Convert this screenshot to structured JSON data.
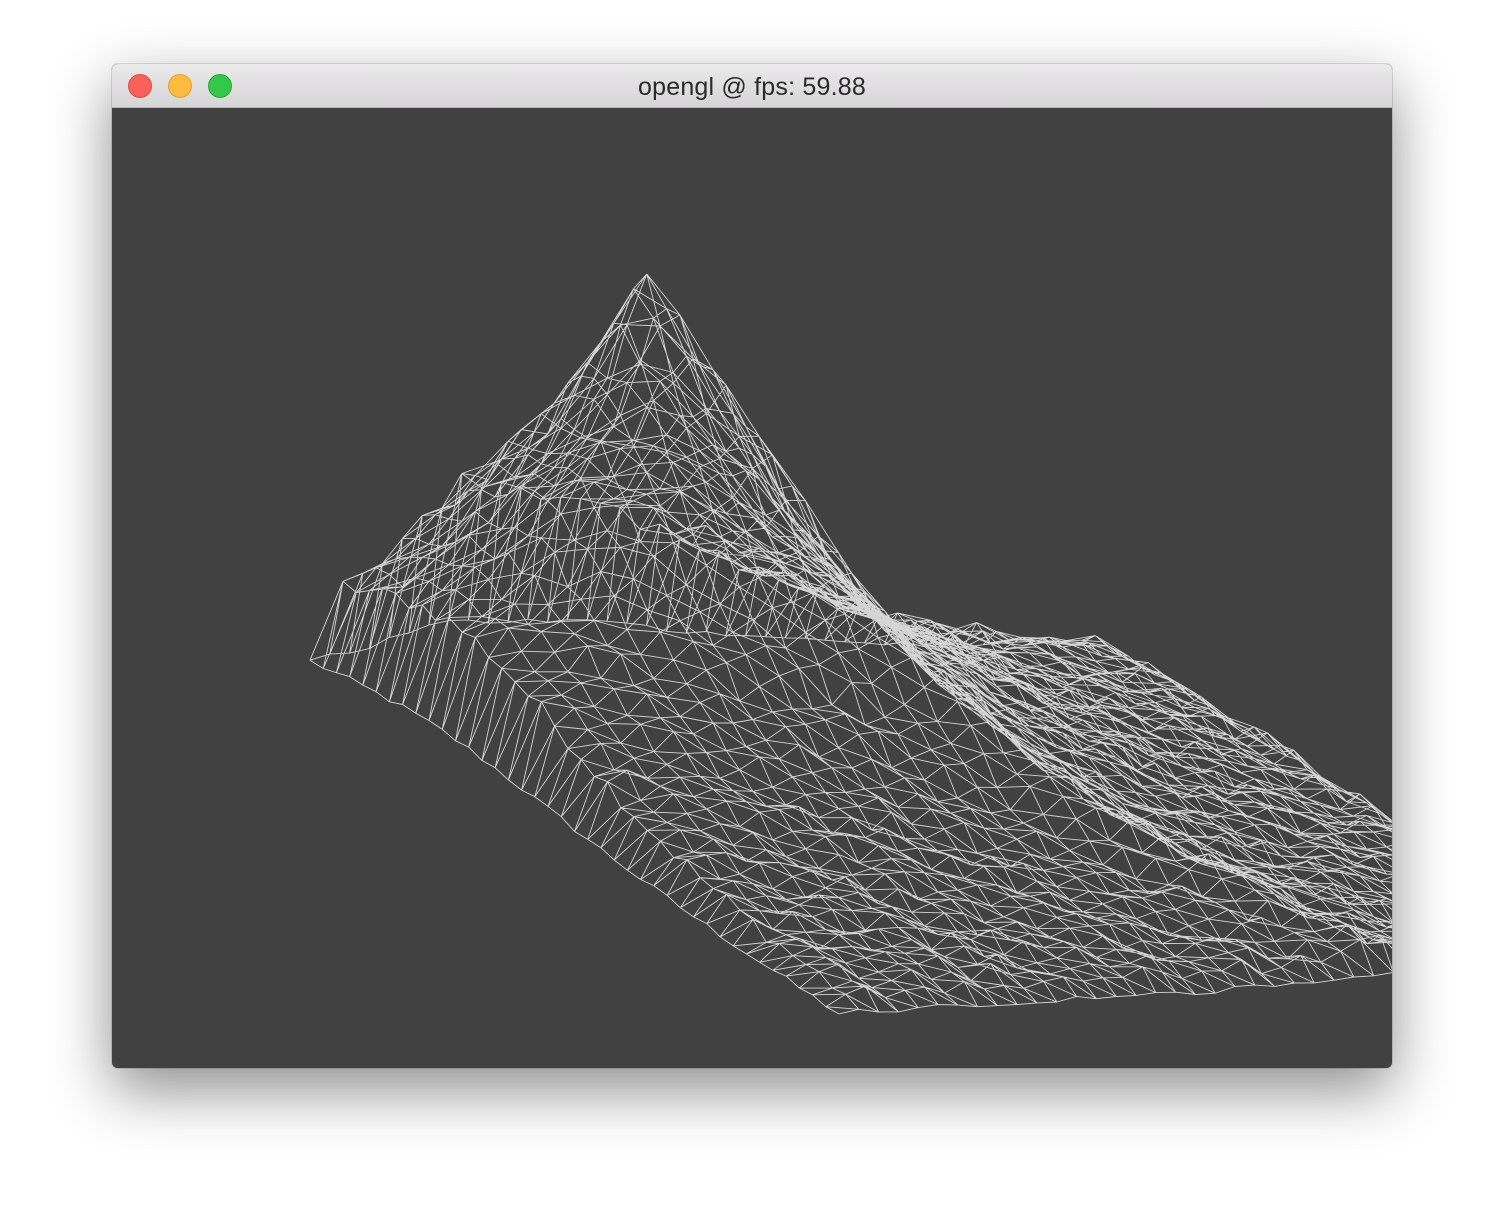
{
  "window": {
    "title": "opengl @ fps: 59.88",
    "controls": {
      "close": "close-button",
      "minimize": "minimize-button",
      "zoom": "zoom-button"
    }
  },
  "viewport": {
    "background_color": "#414141",
    "wire_color": "#ffffff",
    "render_mode": "wireframe",
    "content": "terrain-mesh"
  }
}
